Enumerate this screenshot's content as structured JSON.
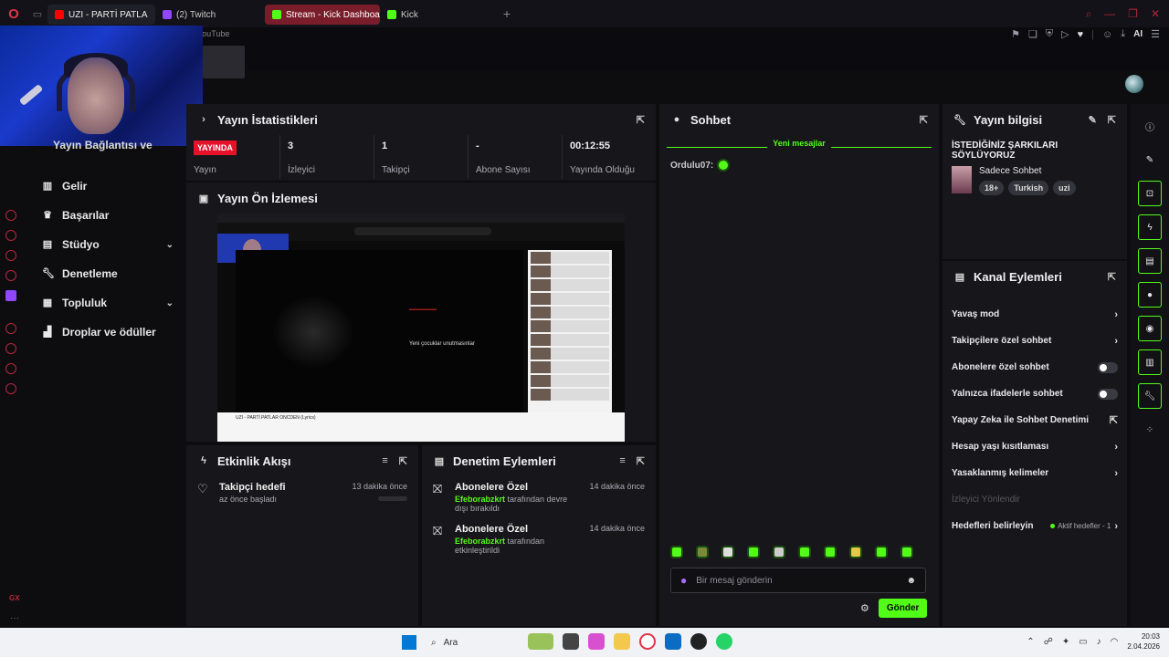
{
  "browser": {
    "tabs": [
      {
        "label": "UZI - PARTİ PATLA",
        "color": "#ff0000"
      },
      {
        "label": "(2) Twitch",
        "color": "#9146ff"
      },
      {
        "label": "Stream - Kick Dashboard",
        "color": "#53fc18"
      },
      {
        "label": "Kick",
        "color": "#53fc18"
      }
    ],
    "tooltip": "YouTube",
    "ai_label": "AI"
  },
  "nav": {
    "cut_label": "Yayın Bağlantısı ve Anahtarı",
    "items": [
      {
        "label": "Gelir",
        "icon": "chart-icon",
        "chevron": false
      },
      {
        "label": "Başarılar",
        "icon": "trophy-icon",
        "chevron": false
      },
      {
        "label": "Stüdyo",
        "icon": "studio-icon",
        "chevron": true
      },
      {
        "label": "Denetleme",
        "icon": "wrench-icon",
        "chevron": false
      },
      {
        "label": "Topluluk",
        "icon": "community-icon",
        "chevron": true
      },
      {
        "label": "Droplar ve ödüller",
        "icon": "drops-icon",
        "chevron": false
      }
    ],
    "side_tag": "GX"
  },
  "stats": {
    "title": "Yayın İstatistikleri",
    "live_badge": "YAYINDA",
    "items": [
      {
        "value": "",
        "label": "Yayın"
      },
      {
        "value": "3",
        "label": "İzleyici"
      },
      {
        "value": "1",
        "label": "Takipçi"
      },
      {
        "value": "-",
        "label": "Abone Sayısı"
      },
      {
        "value": "00:12:55",
        "label": "Yayında Olduğu"
      }
    ]
  },
  "preview": {
    "title": "Yayın Ön İzlemesi",
    "video_caption": "Yeni çocuklar unutmasınlar",
    "video_title": "UZI - PARTİ PATLAR ONCDEN (Lyrics)"
  },
  "activity": {
    "title": "Etkinlik Akışı",
    "items": [
      {
        "title": "Takipçi hedefi",
        "sub": "az önce başladı",
        "time": "13 dakika önce"
      }
    ]
  },
  "mod_actions": {
    "title": "Denetim Eylemleri",
    "items": [
      {
        "title": "Abonelere Özel",
        "user": "Efeborabzkrt",
        "action": "tarafından devre dışı bırakıldı",
        "time": "14 dakika önce"
      },
      {
        "title": "Abonelere Özel",
        "user": "Efeborabzkrt",
        "action": "tarafından etkinleştirildi",
        "time": "14 dakika önce"
      }
    ]
  },
  "chat": {
    "title": "Sohbet",
    "new_messages": "Yeni mesajlar",
    "messages": [
      {
        "user": "Ordulu07:"
      }
    ],
    "input_placeholder": "Bir mesaj gönderin",
    "send_label": "Gönder",
    "emote_count": 10
  },
  "stream_info": {
    "title": "Yayın bilgisi",
    "stream_title": "İSTEDİĞİNİZ ŞARKILARI SÖYLÜYORUZ",
    "category": "Sadece Sohbet",
    "tags": [
      "18+",
      "Turkish",
      "uzi"
    ]
  },
  "channel_actions": {
    "title": "Kanal Eylemleri",
    "items": [
      {
        "label": "Yavaş mod",
        "control": "chevron"
      },
      {
        "label": "Takipçilere özel sohbet",
        "control": "chevron"
      },
      {
        "label": "Abonelere özel sohbet",
        "control": "toggle"
      },
      {
        "label": "Yalnızca ifadelerle sohbet",
        "control": "toggle"
      },
      {
        "label": "Yapay Zeka ile Sohbet Denetimi",
        "control": "external"
      },
      {
        "label": "Hesap yaşı kısıtlaması",
        "control": "chevron"
      },
      {
        "label": "Yasaklanmış kelimeler",
        "control": "chevron"
      },
      {
        "label": "İzleyici Yönlendir",
        "control": "disabled"
      },
      {
        "label": "Hedefleri belirleyin",
        "control": "chevron",
        "status": "Aktif hedefler - 1"
      }
    ]
  },
  "taskbar": {
    "search_label": "Ara",
    "time": "20:03",
    "date": "2.04.2026"
  }
}
